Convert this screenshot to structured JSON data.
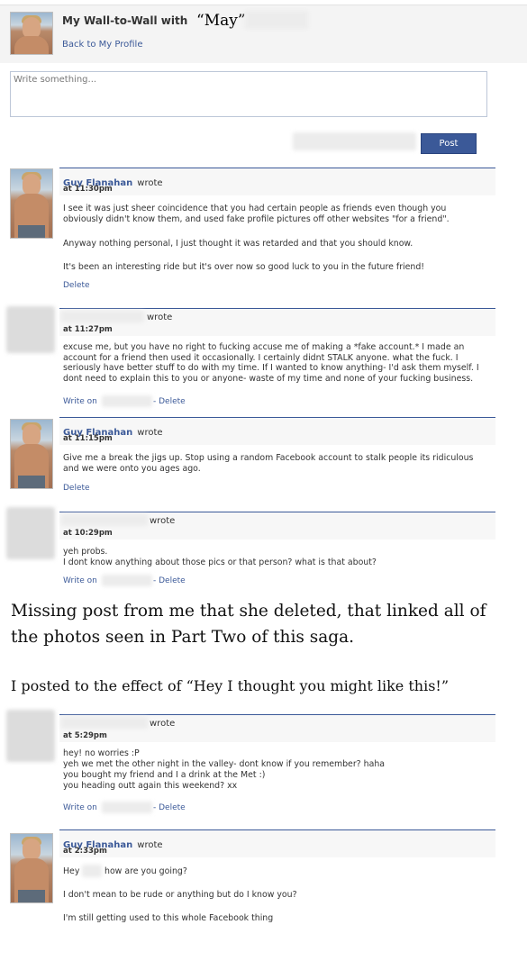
{
  "header": {
    "title_prefix": "My Wall-to-Wall with",
    "title_name": "“May”",
    "back_link": "Back to My Profile"
  },
  "composer": {
    "placeholder": "Write something...",
    "post_label": "Post"
  },
  "posts": [
    {
      "author": "Guy Flanahan",
      "wrote": "wrote",
      "time": "at 11:30pm",
      "paragraphs": [
        "I see it was just sheer coincidence that you had certain people as friends even though you obviously didn't know them, and used fake profile pictures off other websites \"for a friend\".",
        "Anyway nothing personal, I just thought it was retarded and that you should know.",
        "It's been an interesting ride but it's over now so good luck to you in the future friend!"
      ],
      "actions": {
        "delete": "Delete"
      }
    },
    {
      "author": "",
      "wrote": "wrote",
      "time": "at 11:27pm",
      "paragraphs": [
        "excuse me, but you have no right to fucking accuse me of making a *fake account.* I made an account for a friend then used it occasionally. I certainly didnt STALK anyone. what the fuck. I seriously have better stuff to do with my time. If I wanted to know anything- I'd ask them myself. I dont need to explain this to you or anyone- waste of my time and none of your fucking business."
      ],
      "actions": {
        "write_on": "Write on",
        "delete": "- Delete"
      }
    },
    {
      "author": "Guy Flanahan",
      "wrote": "wrote",
      "time": "at 11:15pm",
      "paragraphs": [
        "Give me a break the jigs up. Stop using a random Facebook account to stalk people its ridiculous and we were onto you ages ago."
      ],
      "actions": {
        "delete": "Delete"
      }
    },
    {
      "author": "",
      "wrote": "wrote",
      "time": "at 10:29pm",
      "paragraphs": [
        "yeh probs.",
        "I dont know anything about those pics or that person? what is that about?"
      ],
      "actions": {
        "write_on": "Write on",
        "delete": "- Delete"
      }
    },
    {
      "author": "",
      "wrote": "wrote",
      "time": "at 5:29pm",
      "paragraphs": [
        "hey! no worries :P",
        "yeh we met the other night in the valley- dont know if you remember? haha",
        "you bought my friend and I a drink at the Met :)",
        "you heading outt again this weekend? xx"
      ],
      "actions": {
        "write_on": "Write on",
        "delete": "- Delete"
      }
    },
    {
      "author": "Guy Flanahan",
      "wrote": "wrote",
      "time": "at 2:33pm",
      "line1_a": "Hey",
      "line1_b": "how are you going?",
      "paragraphs": [
        "I don't mean to be rude or anything but do I know you?",
        "I'm still getting used to this whole Facebook thing"
      ]
    }
  ],
  "annotation": {
    "missing_line1": "Missing post from me that she deleted, that linked all of",
    "missing_line2": "the photos seen in Part Two of this saga.",
    "posted_effect": "I posted to the effect of “Hey I thought you might like this!”"
  }
}
